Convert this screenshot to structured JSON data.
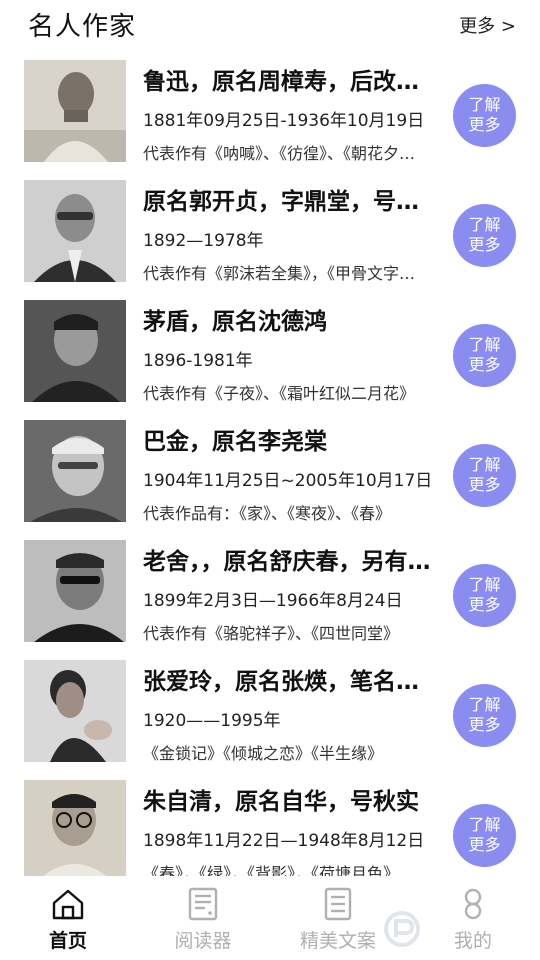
{
  "header": {
    "title": "名人作家",
    "more_label": "更多 >"
  },
  "authors": [
    {
      "name": "鲁迅，原名周樟寿，后改名周树人",
      "dates": "1881年09月25日-1936年10月19日",
      "works": "代表作有《呐喊》、《彷徨》、《朝花夕拾》",
      "btn1": "了解",
      "btn2": "更多"
    },
    {
      "name": "原名郭开贞，字鼎堂，号尚武",
      "dates": "1892—1978年",
      "works": "代表作有《郭沫若全集》，《甲骨文字研究》",
      "btn1": "了解",
      "btn2": "更多"
    },
    {
      "name": "茅盾，原名沈德鸿",
      "dates": "1896-1981年",
      "works": "代表作有《子夜》、《霜叶红似二月花》",
      "btn1": "了解",
      "btn2": "更多"
    },
    {
      "name": "巴金，原名李尧棠",
      "dates": "1904年11月25日~2005年10月17日",
      "works": "代表作品有：《家》、《寒夜》、《春》",
      "btn1": "了解",
      "btn2": "更多"
    },
    {
      "name": "老舍，，原名舒庆春，另有笔名",
      "dates": "1899年2月3日—1966年8月24日",
      "works": "代表作有《骆驼祥子》、《四世同堂》",
      "btn1": "了解",
      "btn2": "更多"
    },
    {
      "name": "张爱玲，原名张煐，笔名梁京",
      "dates": "1920——1995年",
      "works": "《金锁记》《倾城之恋》《半生缘》",
      "btn1": "了解",
      "btn2": "更多"
    },
    {
      "name": "朱自清，原名自华，号秋实",
      "dates": "1898年11月22日—1948年8月12日",
      "works": "《春》，《绿》，《背影》，《荷塘月色》",
      "btn1": "了解",
      "btn2": "更多"
    }
  ],
  "tabs": [
    {
      "label": "首页",
      "icon": "home-icon",
      "active": true
    },
    {
      "label": "阅读器",
      "icon": "reader-icon",
      "active": false
    },
    {
      "label": "精美文案",
      "icon": "document-icon",
      "active": false
    },
    {
      "label": "我的",
      "icon": "profile-icon",
      "active": false
    }
  ],
  "colors": {
    "accent": "#8a8cf0",
    "active_tab": "#111111",
    "inactive_tab": "#b0b0b0"
  }
}
